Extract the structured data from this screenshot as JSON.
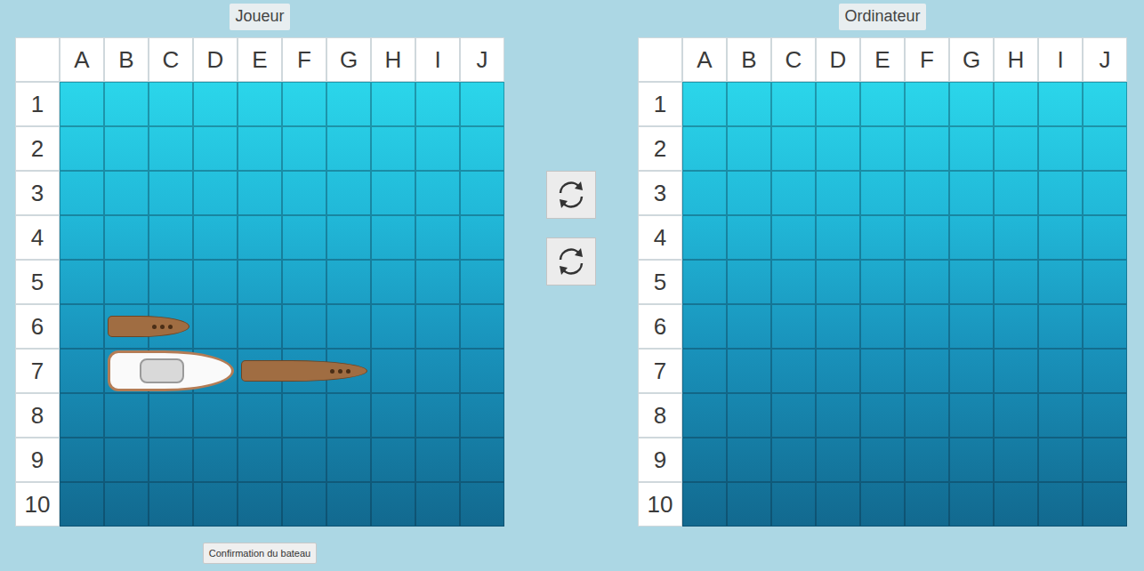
{
  "boards": [
    {
      "title": "Joueur",
      "ships": [
        {
          "kind": "wooden",
          "col": "B",
          "row": "6",
          "length": 2
        },
        {
          "kind": "yacht",
          "col": "B",
          "row": "7",
          "length": 3
        },
        {
          "kind": "wooden",
          "col": "E",
          "row": "7",
          "length": 3
        }
      ]
    },
    {
      "title": "Ordinateur",
      "ships": []
    }
  ],
  "columns": [
    "A",
    "B",
    "C",
    "D",
    "E",
    "F",
    "G",
    "H",
    "I",
    "J"
  ],
  "rows": [
    "1",
    "2",
    "3",
    "4",
    "5",
    "6",
    "7",
    "8",
    "9",
    "10"
  ],
  "controls": [
    {
      "kind": "rotate"
    },
    {
      "kind": "rotate"
    }
  ],
  "confirm_button": "Confirmation du bateau"
}
